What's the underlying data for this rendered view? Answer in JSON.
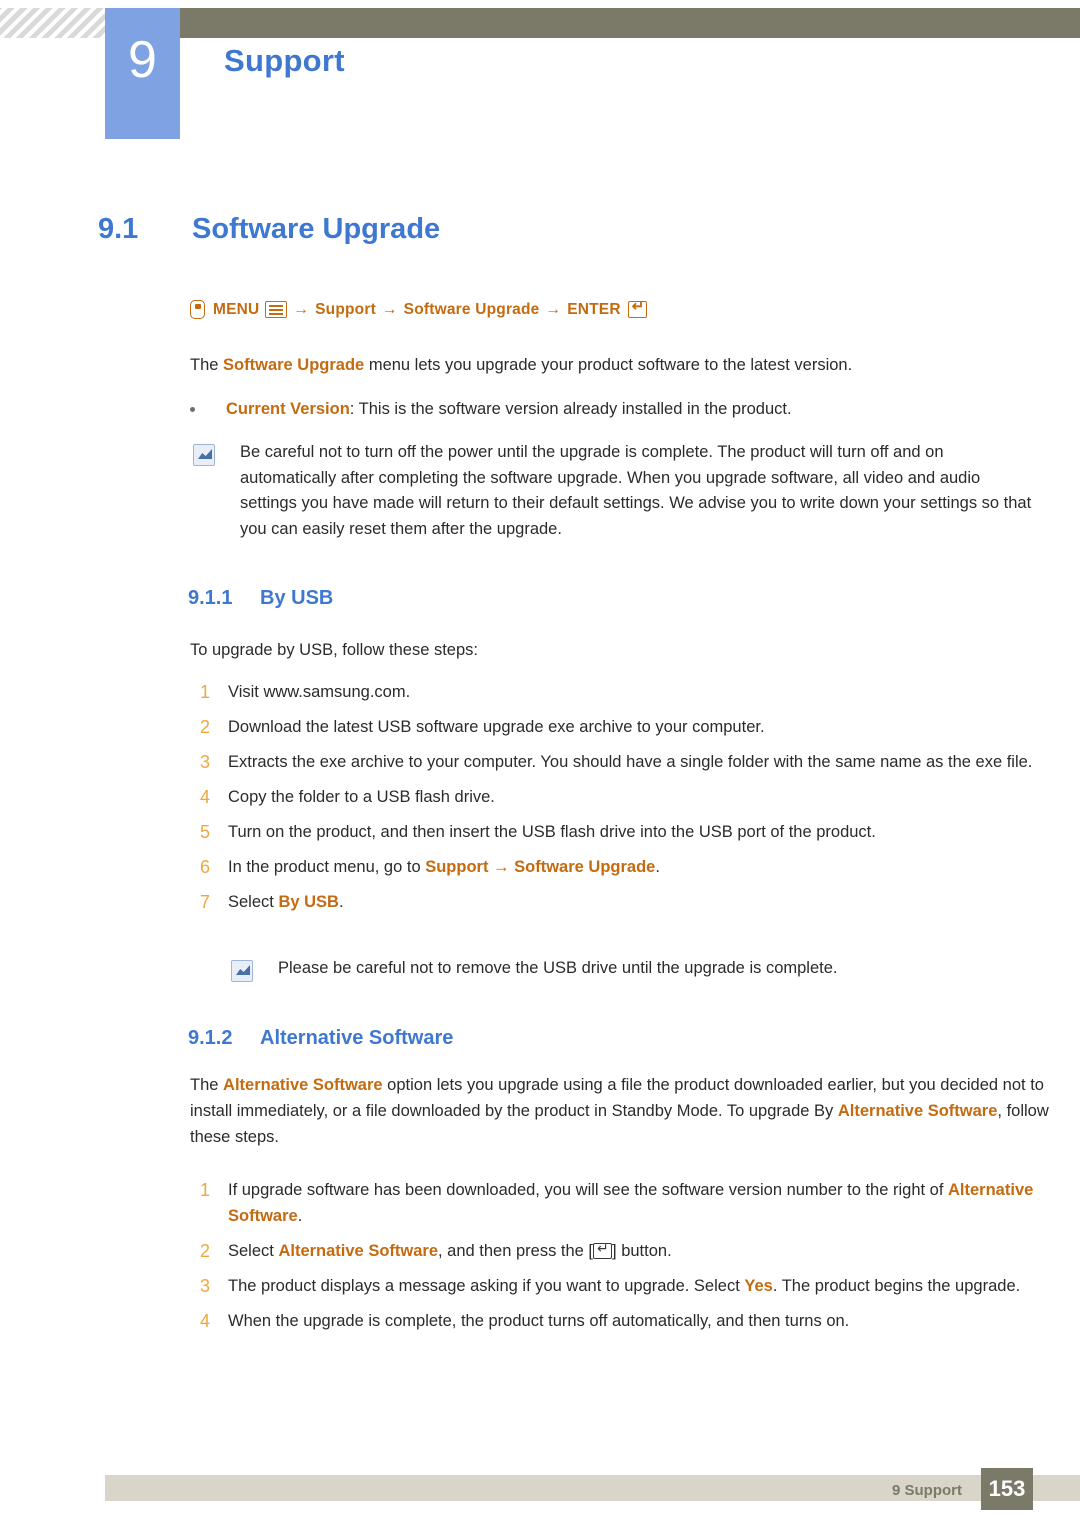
{
  "header": {
    "chapter_number": "9",
    "chapter_title": "Support"
  },
  "section": {
    "number": "9.1",
    "title": "Software Upgrade"
  },
  "menu_path": {
    "remote_icon": "remote-button-icon",
    "menu_label": "MENU",
    "menu_icon": "menu-glyph-icon",
    "arrow1": "→",
    "item1": "Support",
    "arrow2": "→",
    "item2": "Software Upgrade",
    "arrow3": "→",
    "enter_label": "ENTER",
    "enter_icon": "enter-glyph-icon"
  },
  "intro": {
    "pre": "The ",
    "bold": "Software Upgrade",
    "post": " menu lets you upgrade your product software to the latest version."
  },
  "bullet": {
    "bold": "Current Version",
    "text": ": This is the software version already installed in the product."
  },
  "note1": {
    "text": "Be careful not to turn off the power until the upgrade is complete. The product will turn off and on automatically after completing the software upgrade. When you upgrade software, all video and audio settings you have made will return to their default settings. We advise you to write down your settings so that you can easily reset them after the upgrade."
  },
  "subsection_usb": {
    "number": "9.1.1",
    "title": "By USB",
    "intro": "To upgrade by USB, follow these steps:",
    "steps": [
      {
        "num": "1",
        "pre": "Visit www.samsung.com.",
        "bold": "",
        "post": ""
      },
      {
        "num": "2",
        "pre": "Download the latest USB software upgrade exe archive to your computer.",
        "bold": "",
        "post": ""
      },
      {
        "num": "3",
        "pre": "Extracts the exe archive to your computer. You should have a single folder with the same name as the exe file.",
        "bold": "",
        "post": ""
      },
      {
        "num": "4",
        "pre": "Copy the folder to a USB flash drive.",
        "bold": "",
        "post": ""
      },
      {
        "num": "5",
        "pre": "Turn on the product, and then insert the USB flash drive into the USB port of the product.",
        "bold": "",
        "post": ""
      },
      {
        "num": "6",
        "pre": "In the product menu, go to ",
        "bold": "Support",
        "mid": " → ",
        "bold2": "Software Upgrade",
        "post": "."
      },
      {
        "num": "7",
        "pre": "Select ",
        "bold": "By USB",
        "post": "."
      }
    ]
  },
  "note2": {
    "text": "Please be careful not to remove the USB drive until the upgrade is complete."
  },
  "subsection_alt": {
    "number": "9.1.2",
    "title": "Alternative Software",
    "intro_pre": "The ",
    "intro_bold1": "Alternative Software",
    "intro_mid": " option lets you upgrade using a file the product downloaded earlier, but you decided not to install immediately, or a file downloaded by the product in Standby Mode. To upgrade By ",
    "intro_bold2": "Alternative Software",
    "intro_post": ", follow these steps.",
    "steps": [
      {
        "num": "1",
        "pre": "If upgrade software has been downloaded, you will see the software version number to the right of ",
        "bold": "Alternative Software",
        "post": "."
      },
      {
        "num": "2",
        "pre": "Select ",
        "bold": "Alternative Software",
        "mid": ", and then press the [",
        "icon": "enter-button-icon",
        "post": "] button."
      },
      {
        "num": "3",
        "pre": "The product displays a message asking if you want to upgrade. Select ",
        "bold": "Yes",
        "post": ". The product begins the upgrade."
      },
      {
        "num": "4",
        "pre": "When the upgrade is complete, the product turns off automatically, and then turns on.",
        "bold": "",
        "post": ""
      }
    ]
  },
  "footer": {
    "chapter_label": "9 Support",
    "page_number": "153"
  },
  "colors": {
    "accent_blue": "#3f78d0",
    "accent_orange": "#c46b10",
    "chapter_box": "#7ea2e2",
    "header_bar": "#7b7a68",
    "footer_bar": "#d9d5c8",
    "step_number": "#f0a73b"
  }
}
